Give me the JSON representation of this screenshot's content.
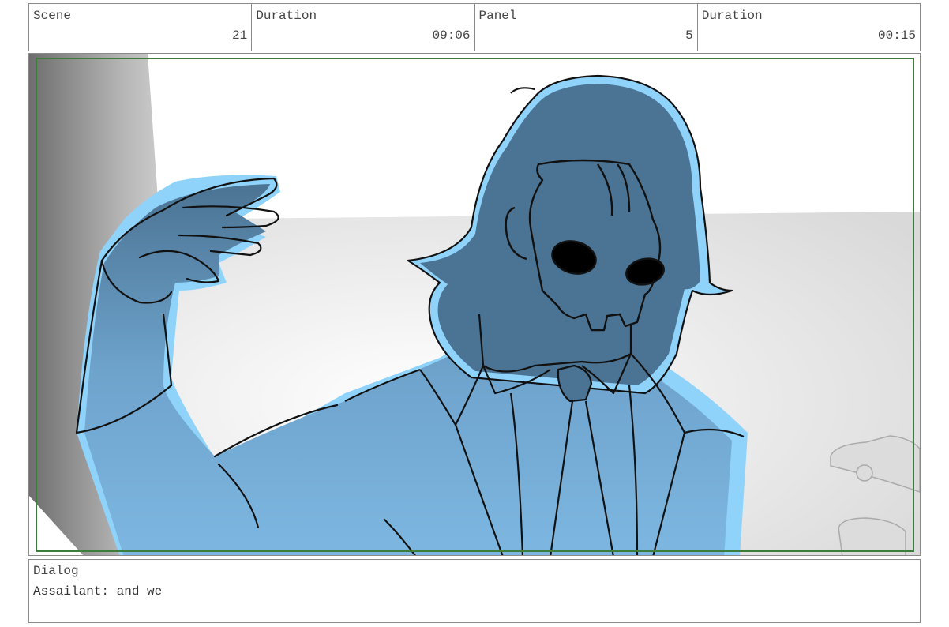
{
  "header": {
    "scene_label": "Scene",
    "scene_value": "21",
    "scene_duration_label": "Duration",
    "scene_duration_value": "09:06",
    "panel_label": "Panel",
    "panel_value": "5",
    "panel_duration_label": "Duration",
    "panel_duration_value": "00:15"
  },
  "dialog": {
    "label": "Dialog",
    "text": "Assailant: and we"
  },
  "colors": {
    "figure_fill": "#79b1d9",
    "figure_rim": "#8fd3fb",
    "safe_frame": "#3c7d3c",
    "ink": "#111111"
  }
}
